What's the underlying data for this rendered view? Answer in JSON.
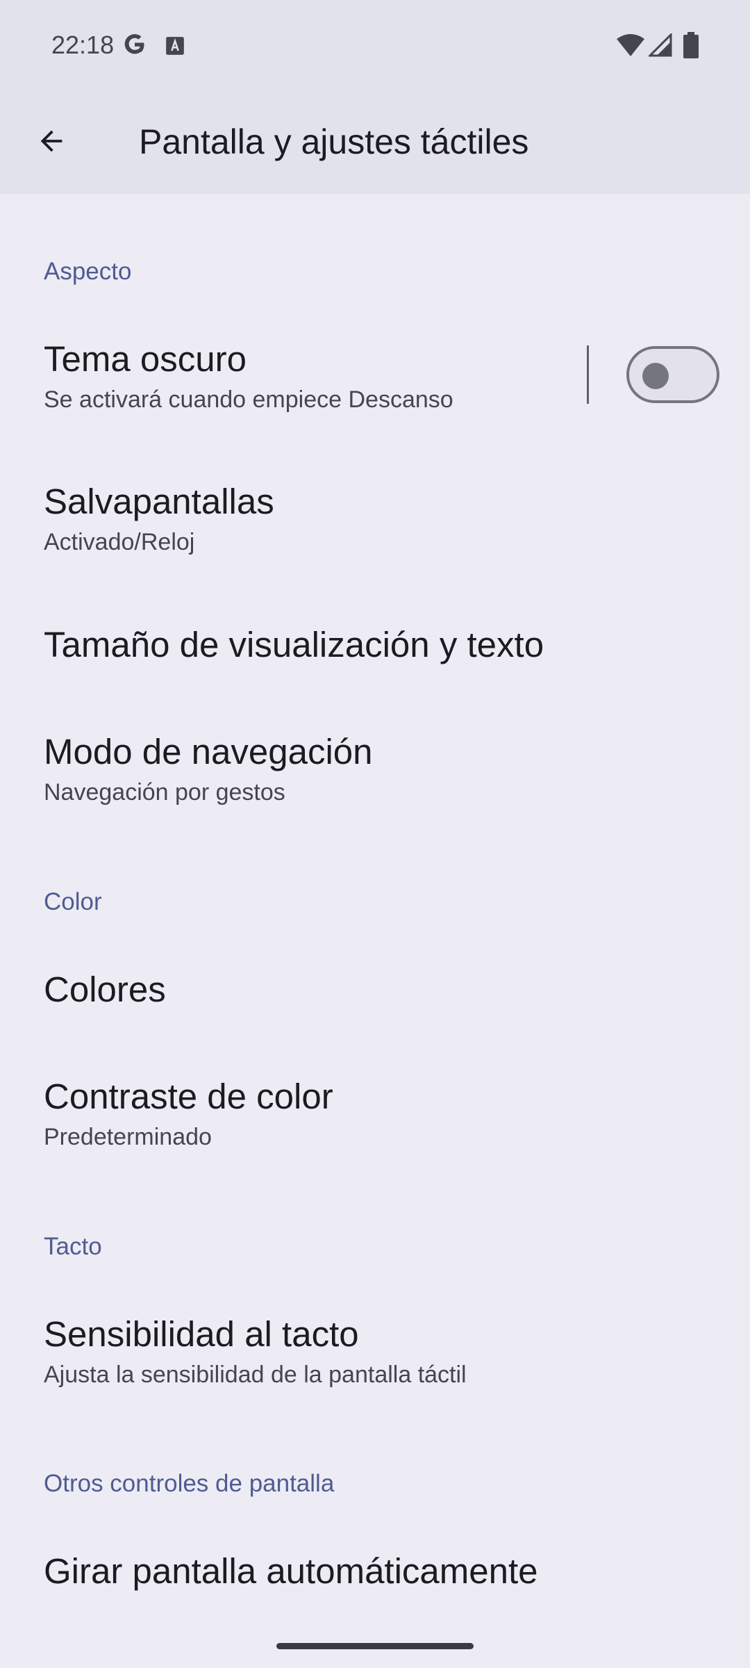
{
  "status_bar": {
    "time": "22:18",
    "icons": [
      "google-g-icon",
      "a-notification-icon",
      "wifi-icon",
      "signal-icon",
      "battery-icon"
    ]
  },
  "app_bar": {
    "back_icon": "arrow-back-icon",
    "title": "Pantalla y ajustes táctiles"
  },
  "sections": {
    "aspecto": {
      "header": "Aspecto",
      "dark_theme": {
        "title": "Tema oscuro",
        "summary": "Se activará cuando empiece Descanso",
        "toggle_on": false
      },
      "screensaver": {
        "title": "Salvapantallas",
        "summary": "Activado/Reloj"
      },
      "display_size": {
        "title": "Tamaño de visualización y texto"
      },
      "navigation_mode": {
        "title": "Modo de navegación",
        "summary": "Navegación por gestos"
      }
    },
    "color": {
      "header": "Color",
      "colors": {
        "title": "Colores"
      },
      "contrast": {
        "title": "Contraste de color",
        "summary": "Predeterminado"
      }
    },
    "tacto": {
      "header": "Tacto",
      "touch_sensitivity": {
        "title": "Sensibilidad al tacto",
        "summary": "Ajusta la sensibilidad de la pantalla táctil"
      }
    },
    "otros": {
      "header": "Otros controles de pantalla",
      "auto_rotate": {
        "title": "Girar pantalla automáticamente"
      }
    }
  },
  "colors": {
    "background": "#edecf4",
    "app_bar": "#e2e2ec",
    "section_header": "#4f5b92",
    "primary_text": "#1b1b21",
    "secondary_text": "#44464f"
  }
}
